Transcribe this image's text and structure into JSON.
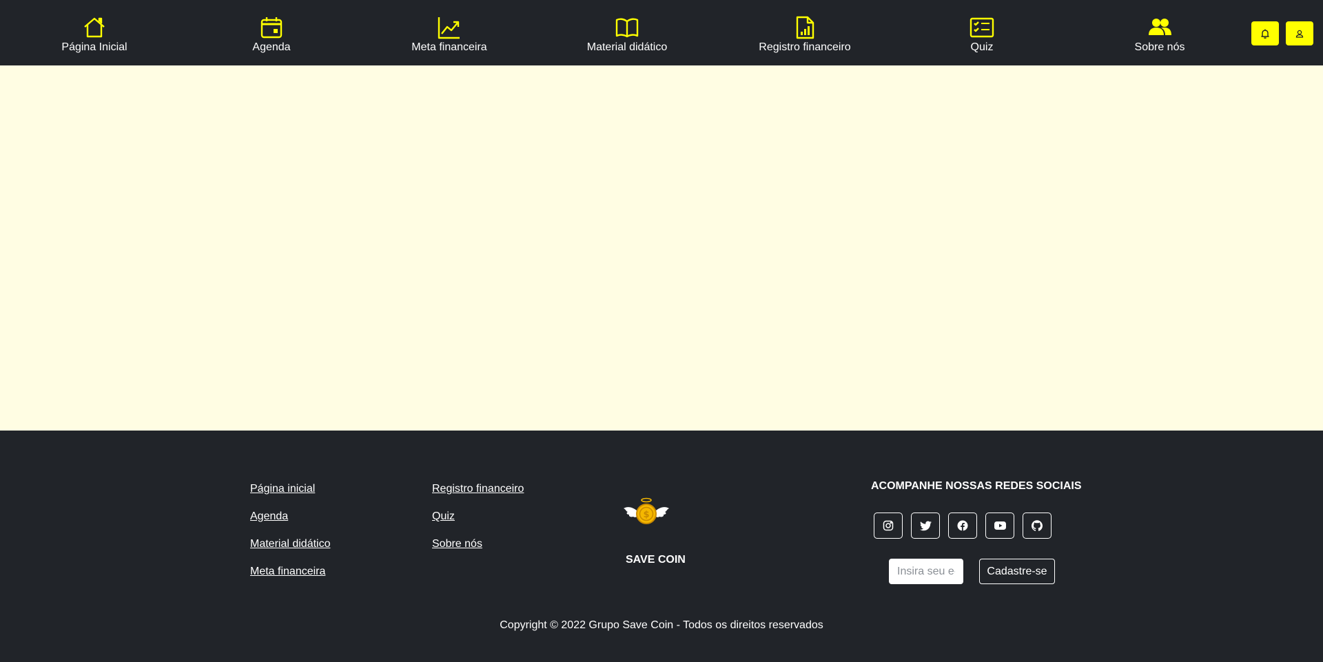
{
  "nav": {
    "items": [
      {
        "label": "Página Inicial",
        "icon": "home-icon"
      },
      {
        "label": "Agenda",
        "icon": "calendar-icon"
      },
      {
        "label": "Meta financeira",
        "icon": "trending-up-icon"
      },
      {
        "label": "Material didático",
        "icon": "book-icon"
      },
      {
        "label": "Registro financeiro",
        "icon": "file-chart-icon"
      },
      {
        "label": "Quiz",
        "icon": "checklist-icon"
      },
      {
        "label": "Sobre nós",
        "icon": "people-icon"
      }
    ],
    "actions": [
      {
        "icon": "bell-icon"
      },
      {
        "icon": "user-icon"
      }
    ]
  },
  "footer": {
    "links_col1": [
      "Página inicial",
      "Agenda",
      "Material didático",
      "Meta financeira"
    ],
    "links_col2": [
      "Registro financeiro",
      "Quiz",
      "Sobre nós"
    ],
    "brand": {
      "name": "SAVE COIN",
      "logo_icon": "winged-coin-logo"
    },
    "social": {
      "title": "ACOMPANHE NOSSAS REDES SOCIAIS",
      "icons": [
        "instagram-icon",
        "twitter-icon",
        "facebook-icon",
        "youtube-icon",
        "github-icon"
      ]
    },
    "newsletter": {
      "email_placeholder": "Insira seu e-mail",
      "email_value": "",
      "button_label": "Cadastre-se"
    },
    "copyright": "Copyright © 2022 Grupo Save Coin - Todos os direitos reservados"
  },
  "colors": {
    "accent": "#ffff00",
    "nav_bg": "#212429",
    "page_bg": "#fffde3",
    "coin": "#f5b800"
  }
}
